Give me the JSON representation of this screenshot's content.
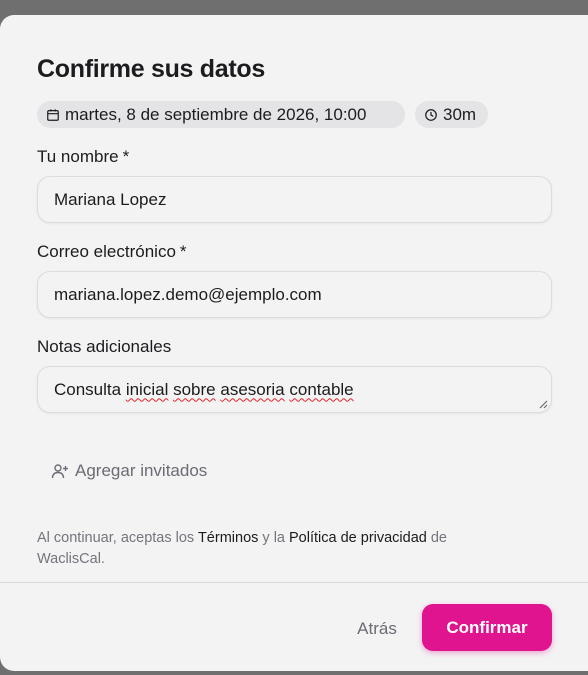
{
  "dialog": {
    "title": "Confirme sus datos",
    "date_chip": "martes, 8 de septiembre de 2026, 10:00",
    "duration_chip": "30m"
  },
  "form": {
    "name": {
      "label": "Tu nombre",
      "required_mark": "*",
      "value": "Mariana Lopez"
    },
    "email": {
      "label": "Correo electrónico",
      "required_mark": "*",
      "value": "mariana.lopez.demo@ejemplo.com"
    },
    "notes": {
      "label": "Notas adicionales",
      "value_parts": [
        "Consulta ",
        "inicial",
        " ",
        "sobre",
        " ",
        "asesoria",
        " ",
        "contable"
      ]
    },
    "add_guests_label": "Agregar invitados"
  },
  "legal": {
    "prefix": "Al continuar, aceptas los ",
    "terms_link": "Términos",
    "middle": " y la ",
    "privacy_link": "Política de privacidad",
    "suffix": " de WaclisCal."
  },
  "footer": {
    "back_label": "Atrás",
    "confirm_label": "Confirmar"
  },
  "colors": {
    "accent": "#e0148e",
    "background": "#f3f3f4",
    "chip": "#e4e4e7"
  },
  "icons": {
    "date": "calendar-icon",
    "duration": "clock-icon",
    "add_guests": "user-plus-icon"
  }
}
